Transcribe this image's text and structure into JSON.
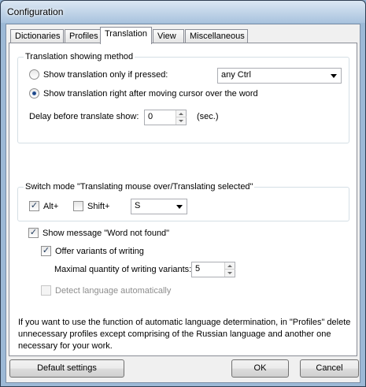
{
  "window": {
    "title": "Configuration"
  },
  "tabs": [
    {
      "label": "Dictionaries"
    },
    {
      "label": "Profiles"
    },
    {
      "label": "Translation"
    },
    {
      "label": "View"
    },
    {
      "label": "Miscellaneous"
    }
  ],
  "active_tab": "Translation",
  "method": {
    "legend": "Translation showing method",
    "option_pressed_label": "Show translation only if pressed:",
    "option_pressed_checked": false,
    "key_combo_value": "any Ctrl",
    "option_immediate_label": "Show translation right after moving cursor over the word",
    "option_immediate_checked": true,
    "delay_label": "Delay before translate show:",
    "delay_value": "0",
    "delay_unit": "(sec.)"
  },
  "switch_mode": {
    "legend": "Switch mode \"Translating mouse over/Translating selected\"",
    "alt_label": "Alt+",
    "alt_checked": true,
    "shift_label": "Shift+",
    "shift_checked": false,
    "key_value": "S"
  },
  "not_found": {
    "show_message_label": "Show message \"Word not found\"",
    "show_message_checked": true,
    "offer_variants_label": "Offer variants of writing",
    "offer_variants_checked": true,
    "max_variants_label": "Maximal quantity of writing variants:",
    "max_variants_value": "5",
    "detect_language_label": "Detect language automatically",
    "detect_language_checked": false
  },
  "info_text": "If you want to use the function of automatic language determination, in \"Profiles\" delete unnecessary profiles except comprising of the Russian language and another one necessary for your work.",
  "buttons": {
    "default_settings": "Default settings",
    "ok": "OK",
    "cancel": "Cancel"
  },
  "icons": {
    "check": "checkmark-icon",
    "combo_arrow": "chevron-down-icon"
  }
}
